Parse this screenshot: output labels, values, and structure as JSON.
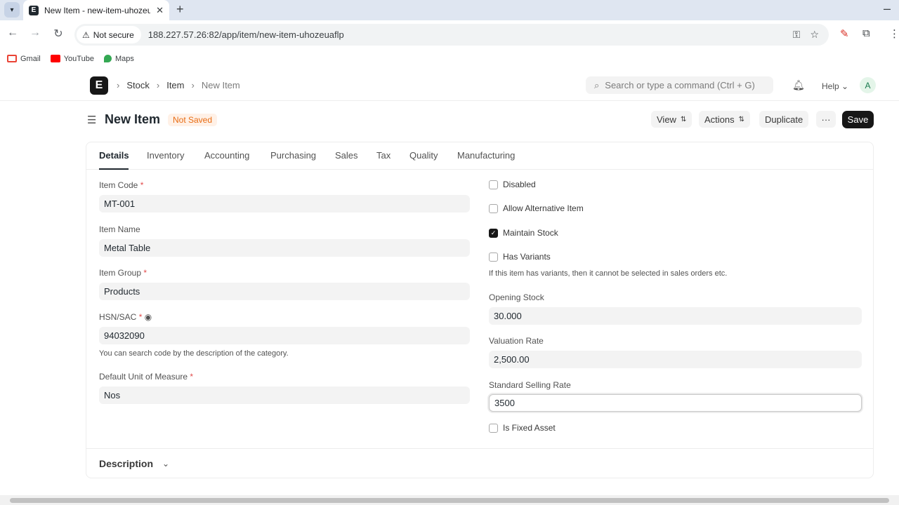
{
  "browser": {
    "tab_title": "New Item - new-item-uhozeuaflp",
    "favicon_letter": "E",
    "security_label": "Not secure",
    "url": "188.227.57.26:82/app/item/new-item-uhozeuaflp",
    "bookmarks": [
      {
        "label": "Gmail",
        "color": "#ea4335"
      },
      {
        "label": "YouTube",
        "color": "#ff0000"
      },
      {
        "label": "Maps",
        "color": "#34a853"
      }
    ]
  },
  "navbar": {
    "logo_letter": "E",
    "breadcrumbs": [
      "Stock",
      "Item",
      "New Item"
    ],
    "search_placeholder": "Search or type a command (Ctrl + G)",
    "help_label": "Help",
    "avatar_letter": "A"
  },
  "page": {
    "title": "New Item",
    "status": "Not Saved",
    "buttons": {
      "view": "View",
      "actions": "Actions",
      "duplicate": "Duplicate",
      "more": "···",
      "save": "Save"
    }
  },
  "tabs": [
    "Details",
    "Inventory",
    "Accounting",
    "Purchasing",
    "Sales",
    "Tax",
    "Quality",
    "Manufacturing"
  ],
  "form_left": {
    "item_code": {
      "label": "Item Code",
      "value": "MT-001"
    },
    "item_name": {
      "label": "Item Name",
      "value": "Metal Table"
    },
    "item_group": {
      "label": "Item Group",
      "value": "Products"
    },
    "hsn": {
      "label": "HSN/SAC",
      "value": "94032090",
      "description": "You can search code by the description of the category."
    },
    "uom": {
      "label": "Default Unit of Measure",
      "value": "Nos"
    }
  },
  "form_right": {
    "disabled": {
      "label": "Disabled",
      "checked": false
    },
    "allow_alternative": {
      "label": "Allow Alternative Item",
      "checked": false
    },
    "maintain_stock": {
      "label": "Maintain Stock",
      "checked": true
    },
    "has_variants": {
      "label": "Has Variants",
      "checked": false,
      "description": "If this item has variants, then it cannot be selected in sales orders etc."
    },
    "opening_stock": {
      "label": "Opening Stock",
      "value": "30.000"
    },
    "valuation_rate": {
      "label": "Valuation Rate",
      "value": "2,500.00"
    },
    "standard_selling_rate": {
      "label": "Standard Selling Rate",
      "value": "3500"
    },
    "is_fixed_asset": {
      "label": "Is Fixed Asset",
      "checked": false
    }
  },
  "description_section": {
    "title": "Description"
  },
  "colors": {
    "accent": "#171717",
    "status_bg": "#fff1e7",
    "status_text": "#e86c13",
    "required": "#e24c4c"
  }
}
